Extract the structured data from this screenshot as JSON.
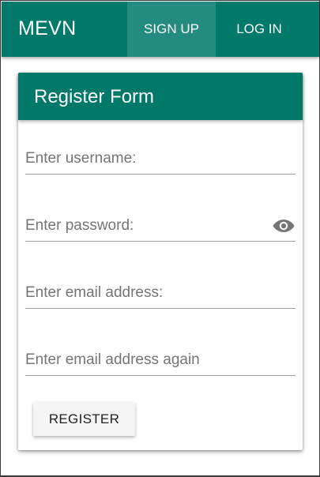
{
  "header": {
    "title": "MEVN",
    "nav": [
      {
        "label": "SIGN UP",
        "active": true
      },
      {
        "label": "LOG IN",
        "active": false
      }
    ]
  },
  "form": {
    "title": "Register Form",
    "fields": {
      "username": {
        "placeholder": "Enter username:",
        "value": ""
      },
      "password": {
        "placeholder": "Enter password:",
        "value": "",
        "toggle_icon": "eye-icon"
      },
      "email": {
        "placeholder": "Enter email address:",
        "value": ""
      },
      "email_confirm": {
        "placeholder": "Enter email address again",
        "value": ""
      }
    },
    "submit_label": "REGISTER"
  },
  "colors": {
    "primary": "#00796b",
    "button_bg": "#f5f5f5",
    "icon": "#757575"
  }
}
